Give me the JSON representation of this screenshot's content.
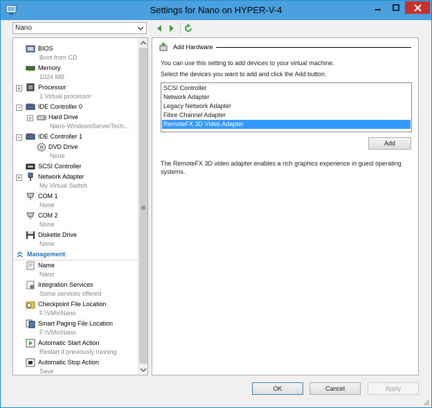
{
  "window": {
    "title": "Settings for Nano on HYPER-V-4",
    "colors": {
      "titlebar": "#4aa0de",
      "close": "#c7312a",
      "selection": "#3399ff",
      "section": "#1e6fb7"
    }
  },
  "toolbar": {
    "vm_selected": "Nano",
    "icons": [
      "back-arrow-icon",
      "forward-arrow-icon",
      "refresh-icon"
    ]
  },
  "hardware_tree": [
    {
      "label": "BIOS",
      "sub": "Boot from CD",
      "icon": "bios-icon"
    },
    {
      "label": "Memory",
      "sub": "1024 MB",
      "icon": "memory-icon"
    },
    {
      "label": "Processor",
      "sub": "1 Virtual processor",
      "icon": "processor-icon"
    },
    {
      "label": "IDE Controller 0",
      "sub": "",
      "icon": "ide-controller-icon"
    },
    {
      "label": "Hard Drive",
      "sub": "Nano-WindowsServerTech...",
      "icon": "hard-drive-icon"
    },
    {
      "label": "IDE Controller 1",
      "sub": "",
      "icon": "ide-controller-icon"
    },
    {
      "label": "DVD Drive",
      "sub": "None",
      "icon": "dvd-drive-icon"
    },
    {
      "label": "SCSI Controller",
      "sub": "",
      "icon": "scsi-controller-icon"
    },
    {
      "label": "Network Adapter",
      "sub": "My Virtual Switch",
      "icon": "network-adapter-icon"
    },
    {
      "label": "COM 1",
      "sub": "None",
      "icon": "com-port-icon"
    },
    {
      "label": "COM 2",
      "sub": "None",
      "icon": "com-port-icon"
    },
    {
      "label": "Diskette Drive",
      "sub": "None",
      "icon": "diskette-icon"
    }
  ],
  "management_header": "Management",
  "management_tree": [
    {
      "label": "Name",
      "sub": "Nano",
      "icon": "name-icon"
    },
    {
      "label": "Integration Services",
      "sub": "Some services offered",
      "icon": "integration-services-icon"
    },
    {
      "label": "Checkpoint File Location",
      "sub": "F:\\VMs\\Nano",
      "icon": "checkpoint-icon"
    },
    {
      "label": "Smart Paging File Location",
      "sub": "F:\\VMs\\Nano",
      "icon": "smart-paging-icon"
    },
    {
      "label": "Automatic Start Action",
      "sub": "Restart if previously running",
      "icon": "start-action-icon"
    },
    {
      "label": "Automatic Stop Action",
      "sub": "Save",
      "icon": "stop-action-icon"
    }
  ],
  "add_hardware": {
    "header": "Add Hardware",
    "intro": "You can use this setting to add devices to your virtual machine.",
    "instruction": "Select the devices you want to add and click the Add button.",
    "devices": [
      "SCSI Controller",
      "Network Adapter",
      "Legacy Network Adapter",
      "Fibre Channel Adapter",
      "RemoteFX 3D Video Adapter"
    ],
    "selected_index": 4,
    "add_label": "Add",
    "description": "The RemoteFX 3D video adapter enables a rich graphics experience in guest operating systems."
  },
  "footer": {
    "ok": "OK",
    "cancel": "Cancel",
    "apply": "Apply"
  }
}
